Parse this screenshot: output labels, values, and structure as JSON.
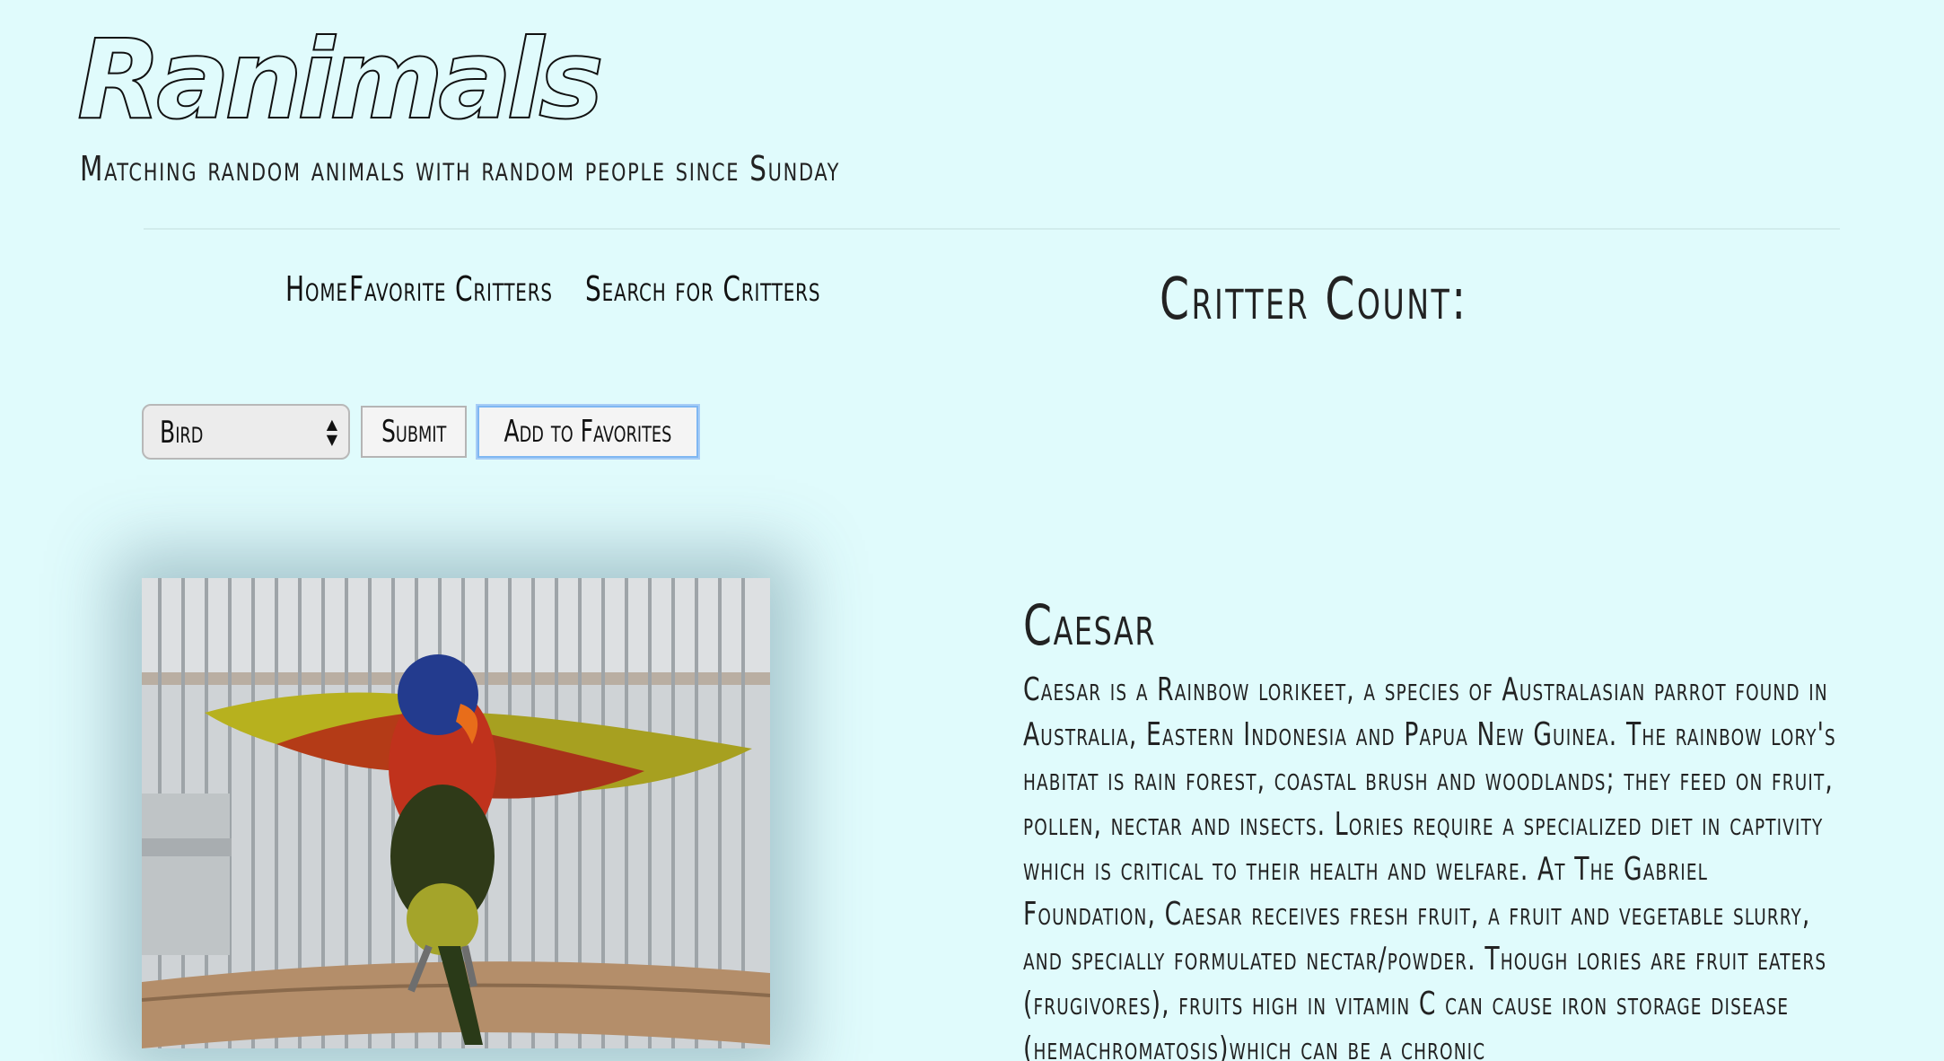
{
  "site": {
    "title": "Ranimals",
    "tagline": "Matching random animals with random people since Sunday"
  },
  "nav": {
    "items": [
      {
        "label": "Home"
      },
      {
        "label": "Favorite Critters"
      },
      {
        "label": "Search for Critters"
      }
    ]
  },
  "critter_count": {
    "label": "Critter Count:"
  },
  "controls": {
    "animal_type": {
      "selected": "Bird"
    },
    "submit_label": "Submit",
    "add_favorites_label": "Add to Favorites"
  },
  "critter": {
    "name": "Caesar",
    "description": "Caesar is a Rainbow lorikeet, a species of Australasian parrot found in Australia, Eastern Indonesia and Papua New Guinea. The rainbow lory's habitat is rain forest, coastal brush and woodlands; they feed on fruit, pollen, nectar and insects. Lories require a specialized diet in captivity which is critical to their health and welfare. At The Gabriel Foundation, Caesar receives fresh fruit, a fruit and vegetable slurry, and specially formulated nectar/powder. Though lories are fruit eaters (frugivores), fruits high in vitamin C can cause iron storage disease (hemachromatosis)which can be a chronic"
  },
  "icons": {
    "select_arrows": "up-down-arrows-icon"
  },
  "colors": {
    "background": "#e0fbfc",
    "focus_ring": "#7fb7f2"
  }
}
